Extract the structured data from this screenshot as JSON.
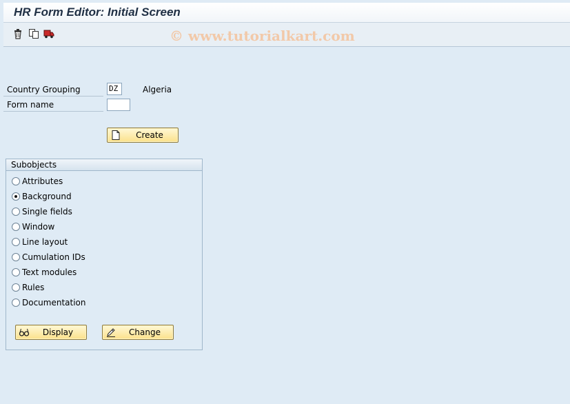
{
  "window": {
    "title": "HR Form Editor: Initial Screen"
  },
  "watermark": "© www.tutorialkart.com",
  "toolbar": {
    "icons": [
      "delete-icon",
      "copy-icon",
      "transport-icon"
    ]
  },
  "form": {
    "country_grouping_label": "Country Grouping",
    "country_grouping_value": "DZ",
    "country_grouping_text": "Algeria",
    "form_name_label": "Form name",
    "form_name_value": "",
    "create_label": "Create"
  },
  "subobjects": {
    "title": "Subobjects",
    "options": [
      {
        "label": "Attributes",
        "selected": false
      },
      {
        "label": "Background",
        "selected": true
      },
      {
        "label": "Single fields",
        "selected": false
      },
      {
        "label": "Window",
        "selected": false
      },
      {
        "label": "Line layout",
        "selected": false
      },
      {
        "label": "Cumulation IDs",
        "selected": false
      },
      {
        "label": "Text modules",
        "selected": false
      },
      {
        "label": "Rules",
        "selected": false
      },
      {
        "label": "Documentation",
        "selected": false
      }
    ],
    "display_label": "Display",
    "change_label": "Change"
  }
}
